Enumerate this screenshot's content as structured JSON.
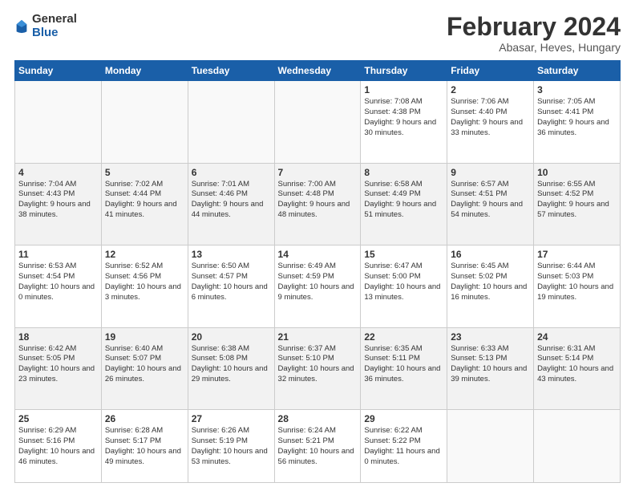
{
  "header": {
    "logo_general": "General",
    "logo_blue": "Blue",
    "main_title": "February 2024",
    "subtitle": "Abasar, Heves, Hungary"
  },
  "days_of_week": [
    "Sunday",
    "Monday",
    "Tuesday",
    "Wednesday",
    "Thursday",
    "Friday",
    "Saturday"
  ],
  "weeks": [
    {
      "days": [
        {
          "num": "",
          "info": ""
        },
        {
          "num": "",
          "info": ""
        },
        {
          "num": "",
          "info": ""
        },
        {
          "num": "",
          "info": ""
        },
        {
          "num": "1",
          "info": "Sunrise: 7:08 AM\nSunset: 4:38 PM\nDaylight: 9 hours\nand 30 minutes."
        },
        {
          "num": "2",
          "info": "Sunrise: 7:06 AM\nSunset: 4:40 PM\nDaylight: 9 hours\nand 33 minutes."
        },
        {
          "num": "3",
          "info": "Sunrise: 7:05 AM\nSunset: 4:41 PM\nDaylight: 9 hours\nand 36 minutes."
        }
      ]
    },
    {
      "days": [
        {
          "num": "4",
          "info": "Sunrise: 7:04 AM\nSunset: 4:43 PM\nDaylight: 9 hours\nand 38 minutes."
        },
        {
          "num": "5",
          "info": "Sunrise: 7:02 AM\nSunset: 4:44 PM\nDaylight: 9 hours\nand 41 minutes."
        },
        {
          "num": "6",
          "info": "Sunrise: 7:01 AM\nSunset: 4:46 PM\nDaylight: 9 hours\nand 44 minutes."
        },
        {
          "num": "7",
          "info": "Sunrise: 7:00 AM\nSunset: 4:48 PM\nDaylight: 9 hours\nand 48 minutes."
        },
        {
          "num": "8",
          "info": "Sunrise: 6:58 AM\nSunset: 4:49 PM\nDaylight: 9 hours\nand 51 minutes."
        },
        {
          "num": "9",
          "info": "Sunrise: 6:57 AM\nSunset: 4:51 PM\nDaylight: 9 hours\nand 54 minutes."
        },
        {
          "num": "10",
          "info": "Sunrise: 6:55 AM\nSunset: 4:52 PM\nDaylight: 9 hours\nand 57 minutes."
        }
      ]
    },
    {
      "days": [
        {
          "num": "11",
          "info": "Sunrise: 6:53 AM\nSunset: 4:54 PM\nDaylight: 10 hours\nand 0 minutes."
        },
        {
          "num": "12",
          "info": "Sunrise: 6:52 AM\nSunset: 4:56 PM\nDaylight: 10 hours\nand 3 minutes."
        },
        {
          "num": "13",
          "info": "Sunrise: 6:50 AM\nSunset: 4:57 PM\nDaylight: 10 hours\nand 6 minutes."
        },
        {
          "num": "14",
          "info": "Sunrise: 6:49 AM\nSunset: 4:59 PM\nDaylight: 10 hours\nand 9 minutes."
        },
        {
          "num": "15",
          "info": "Sunrise: 6:47 AM\nSunset: 5:00 PM\nDaylight: 10 hours\nand 13 minutes."
        },
        {
          "num": "16",
          "info": "Sunrise: 6:45 AM\nSunset: 5:02 PM\nDaylight: 10 hours\nand 16 minutes."
        },
        {
          "num": "17",
          "info": "Sunrise: 6:44 AM\nSunset: 5:03 PM\nDaylight: 10 hours\nand 19 minutes."
        }
      ]
    },
    {
      "days": [
        {
          "num": "18",
          "info": "Sunrise: 6:42 AM\nSunset: 5:05 PM\nDaylight: 10 hours\nand 23 minutes."
        },
        {
          "num": "19",
          "info": "Sunrise: 6:40 AM\nSunset: 5:07 PM\nDaylight: 10 hours\nand 26 minutes."
        },
        {
          "num": "20",
          "info": "Sunrise: 6:38 AM\nSunset: 5:08 PM\nDaylight: 10 hours\nand 29 minutes."
        },
        {
          "num": "21",
          "info": "Sunrise: 6:37 AM\nSunset: 5:10 PM\nDaylight: 10 hours\nand 32 minutes."
        },
        {
          "num": "22",
          "info": "Sunrise: 6:35 AM\nSunset: 5:11 PM\nDaylight: 10 hours\nand 36 minutes."
        },
        {
          "num": "23",
          "info": "Sunrise: 6:33 AM\nSunset: 5:13 PM\nDaylight: 10 hours\nand 39 minutes."
        },
        {
          "num": "24",
          "info": "Sunrise: 6:31 AM\nSunset: 5:14 PM\nDaylight: 10 hours\nand 43 minutes."
        }
      ]
    },
    {
      "days": [
        {
          "num": "25",
          "info": "Sunrise: 6:29 AM\nSunset: 5:16 PM\nDaylight: 10 hours\nand 46 minutes."
        },
        {
          "num": "26",
          "info": "Sunrise: 6:28 AM\nSunset: 5:17 PM\nDaylight: 10 hours\nand 49 minutes."
        },
        {
          "num": "27",
          "info": "Sunrise: 6:26 AM\nSunset: 5:19 PM\nDaylight: 10 hours\nand 53 minutes."
        },
        {
          "num": "28",
          "info": "Sunrise: 6:24 AM\nSunset: 5:21 PM\nDaylight: 10 hours\nand 56 minutes."
        },
        {
          "num": "29",
          "info": "Sunrise: 6:22 AM\nSunset: 5:22 PM\nDaylight: 11 hours\nand 0 minutes."
        },
        {
          "num": "",
          "info": ""
        },
        {
          "num": "",
          "info": ""
        }
      ]
    }
  ]
}
